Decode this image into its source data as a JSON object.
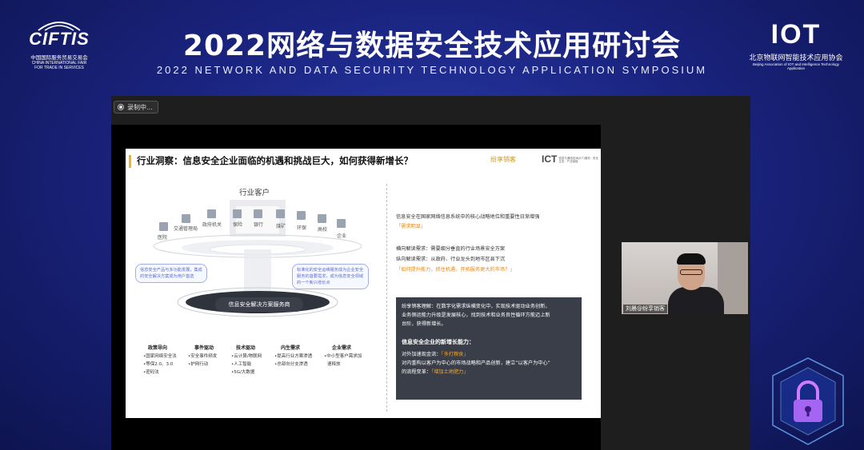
{
  "banner": {
    "title": "2022网络与数据安全技术应用研讨会",
    "subtitle": "2022 NETWORK AND DATA SECURITY TECHNOLOGY APPLICATION SYMPOSIUM",
    "left_logo": {
      "mark": "CIFTIS",
      "cn": "中国国际服务贸易交易会",
      "en_1": "CHINA INTERNATIONAL FAIR",
      "en_2": "FOR TRADE IN SERVICES"
    },
    "right_logo": {
      "mark": "IOT",
      "cn": "北京物联网智能技术应用协会",
      "en": "Beijing Association of IOT and Intelligence Technology Application"
    }
  },
  "meeting": {
    "recording_label": "录制中...",
    "participant_name": "刘晨@纷享销客",
    "accent_color": "#f3b31a"
  },
  "slide": {
    "title": "行业洞察：信息安全企业面临的机遇和挑战巨大，如何获得新增长？",
    "logo_fenxiang": "纷享销客",
    "logo_ict": "ICT",
    "logo_ict_desc": "信息与通信技术(ICT)服务 · 安全生态 · 产业赋能",
    "diagram": {
      "industry_header": "行业客户",
      "industries": [
        "医院",
        "交通管理局",
        "政府机关",
        "保险",
        "银行",
        "煤矿",
        "环保",
        "高校",
        "企业"
      ],
      "left_note": "信息安全产品与多功能发展，集成的安全解决方案成为用户首选",
      "right_note": "标准化的安全运维服务成为企业安全服务的首要需求，成为信息安全领域的一个新兴增长点",
      "core": "信息安全解决方案服务商",
      "columns": [
        {
          "head": "政策导向",
          "items": [
            "•国家网络安全法",
            "•等保2.0、3.0",
            "•密码法"
          ]
        },
        {
          "head": "事件驱动",
          "items": [
            "•安全事件频发",
            "•护网行动"
          ]
        },
        {
          "head": "技术驱动",
          "items": [
            "•云计算/物联网",
            "•人工智能",
            "•5G/大数据"
          ]
        },
        {
          "head": "内生需求",
          "items": [
            "•提高行业方案渗透",
            "•总部向分支渗透"
          ]
        },
        {
          "head": "企业需求",
          "items": [
            "•中小型客户需求加",
            "速释放"
          ]
        }
      ]
    },
    "right": {
      "p1_line1": "信息安全在国家网络信息系统中的核心战略地位和重要性日渐增强",
      "p1_highlight": "「需求明显」",
      "p2_line1": "横向解读需求：需要细分垂直的行业场景安全方案",
      "p2_line2": "纵向解读需求：从政府、行业龙头到地市区县下沉",
      "p2_highlight": "「如何提升能力，抓住机遇，开拓服务更大的市场？」",
      "box": {
        "line1": "纷享销客理解：在数字化需求纵横变化中，实现技术驱动业务创新，",
        "line2": "业务侧运能力升级是发展核心，找到技术和业务良性循环方能迈上新",
        "line3": "台阶，获得新增长。",
        "heading": "信息安全企业的新增长能力：",
        "l4_prefix": "对外加速现金流：",
        "l4_hl": "「多打粮食」",
        "l5": "对内重构以客户为中心的市场战略和产品创新，建立“以客户为中心”",
        "l6_prefix": "的流程变革：",
        "l6_hl": "「增加土地肥力」"
      }
    }
  }
}
